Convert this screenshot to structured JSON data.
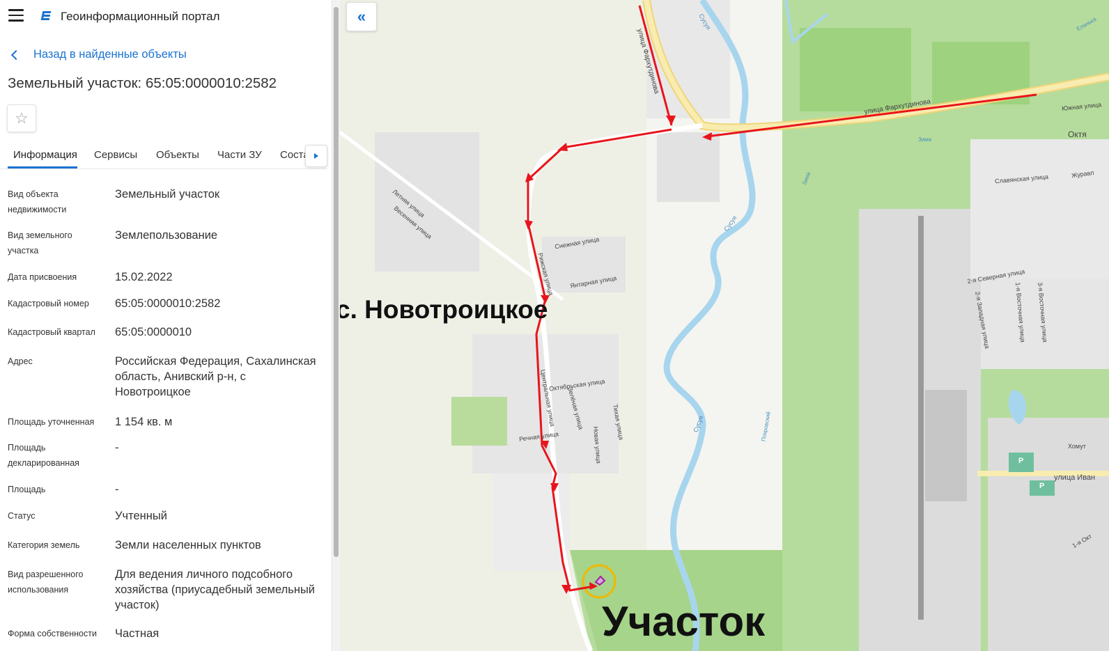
{
  "header": {
    "app_title": "Геоинформационный портал"
  },
  "nav": {
    "back_label": "Назад в найденные объекты"
  },
  "object": {
    "title": "Земельный участок: 65:05:0000010:2582"
  },
  "tabs": [
    {
      "label": "Информация"
    },
    {
      "label": "Сервисы"
    },
    {
      "label": "Объекты"
    },
    {
      "label": "Части ЗУ"
    },
    {
      "label": "Соста"
    }
  ],
  "fields": [
    {
      "label": "Вид объекта недвижимости",
      "value": "Земельный участок"
    },
    {
      "label": "Вид земельного участка",
      "value": "Землепользование"
    },
    {
      "label": "Дата присвоения",
      "value": "15.02.2022"
    },
    {
      "label": "Кадастровый номер",
      "value": "65:05:0000010:2582"
    },
    {
      "label": "Кадастровый квартал",
      "value": "65:05:0000010"
    },
    {
      "label": "Адрес",
      "value": "Российская Федерация, Сахалинская область, Анивский р-н, с Новотроицкое"
    },
    {
      "label": "Площадь уточненная",
      "value": "1 154 кв. м"
    },
    {
      "label": "Площадь декларированная",
      "value": "-"
    },
    {
      "label": "Площадь",
      "value": "-"
    },
    {
      "label": "Статус",
      "value": "Учтенный"
    },
    {
      "label": "Категория земель",
      "value": "Земли населенных пунктов"
    },
    {
      "label": "Вид разрешенного использования",
      "value": "Для ведения личного подсобного хозяйства (приусадебный земельный участок)"
    },
    {
      "label": "Форма собственности",
      "value": "Частная"
    }
  ],
  "map": {
    "village_label": "с. Новотроицкое",
    "plot_label": "Участок",
    "streets": {
      "farkhutdinova": "улица Фархутдинова",
      "snezhnaya": "Снежная улица",
      "rizhskaya": "Рижская улица",
      "yantarnaya": "Янтарная улица",
      "letnyaya": "Летняя улица",
      "vesennyaya": "Весенняя улица",
      "oktyabrskaya": "Октябрьская улица",
      "tsentralnaya": "Центральная улица",
      "zelenaya": "Зелёная улица",
      "tikhaya": "Тихая улица",
      "rechnaya": "Речная улица",
      "novaya": "Новая улица",
      "slavyanskaya": "Славянская улица",
      "severnaya2": "2-я Северная улица",
      "zapadnaya2": "2-я Западная улица",
      "vostochnaya1": "1-я Восточная улица",
      "vostochnaya3": "3-я Восточная улица",
      "yuzhnaya": "Южная улица",
      "ivan": "улица Иван",
      "okt_partial": "Октя",
      "zhurav": "Журавл",
      "susuya1": "Сусуя",
      "susuya2": "Сусуя",
      "susuya3": "Сусуя",
      "zima1": "Зима",
      "zima2": "Зима",
      "pokrovsky": "Покровский",
      "elan": "Еланька",
      "khomut": "Хомут",
      "first_okt": "1-я Окт"
    },
    "parking_letter": "P"
  },
  "colors": {
    "accent": "#1a73d1",
    "route": "#e8141b",
    "highlight": "#f0b800",
    "parcel": "#a020a0",
    "forest": "#a8d890",
    "meadow": "#c8e6a8",
    "road": "#f7e9a0",
    "river": "#b8dcf0"
  }
}
